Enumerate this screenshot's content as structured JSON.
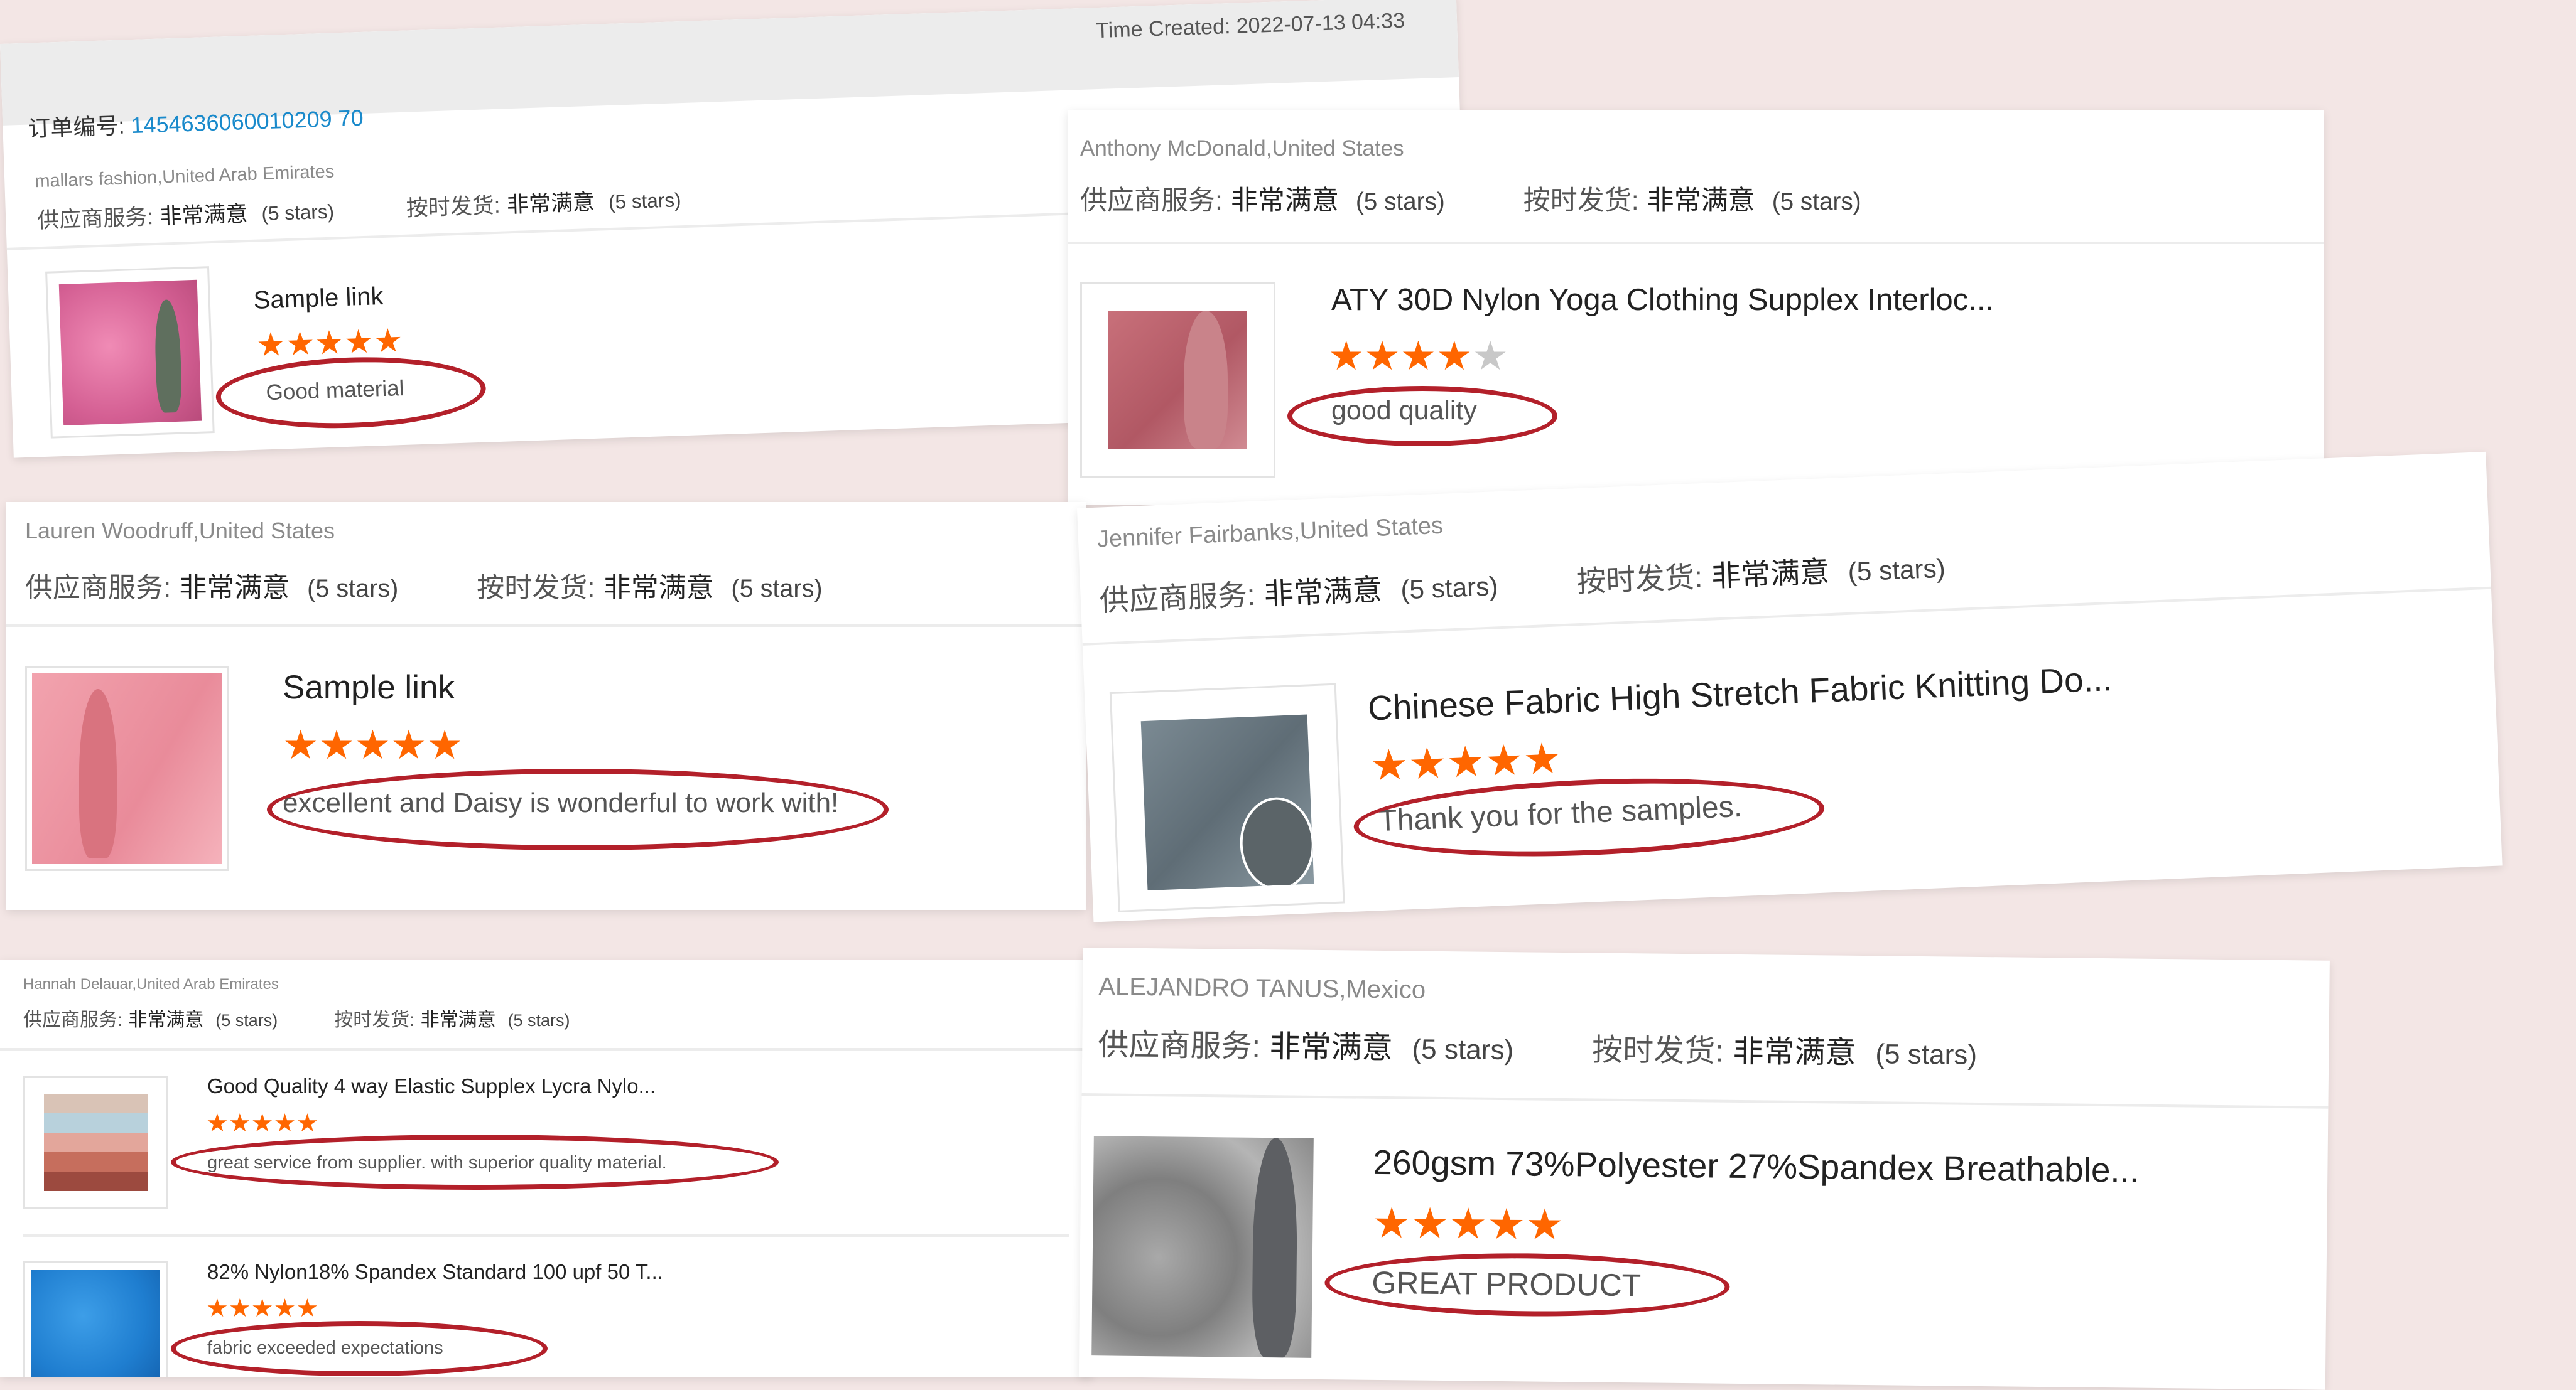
{
  "order": {
    "time_created_label": "Time Created:",
    "time_created_value": "2022-07-13 04:33",
    "number_label": "订单编号:",
    "number_value": "1454636060010209 70"
  },
  "reviews": [
    {
      "reviewer": "mallars fashion,United Arab Emirates",
      "service_label": "供应商服务:",
      "service_value": "非常满意",
      "service_stars": "(5 stars)",
      "delivery_label": "按时发货:",
      "delivery_value": "非常满意",
      "delivery_stars": "(5 stars)",
      "product_name": "Sample link",
      "stars": "★★★★★",
      "stars_off": "",
      "rating": 5,
      "comment": "Good material"
    },
    {
      "reviewer": "Anthony McDonald,United States",
      "service_label": "供应商服务:",
      "service_value": "非常满意",
      "service_stars": "(5 stars)",
      "delivery_label": "按时发货:",
      "delivery_value": "非常满意",
      "delivery_stars": "(5 stars)",
      "product_name": "ATY 30D Nylon Yoga Clothing Supplex Interloc...",
      "stars": "★★★★",
      "stars_off": "★",
      "rating": 4,
      "comment": "good quality"
    },
    {
      "reviewer": "Lauren Woodruff,United States",
      "service_label": "供应商服务:",
      "service_value": "非常满意",
      "service_stars": "(5 stars)",
      "delivery_label": "按时发货:",
      "delivery_value": "非常满意",
      "delivery_stars": "(5 stars)",
      "product_name": "Sample link",
      "stars": "★★★★★",
      "stars_off": "",
      "rating": 5,
      "comment": "excellent and Daisy is wonderful to work with!"
    },
    {
      "reviewer": "Jennifer Fairbanks,United States",
      "service_label": "供应商服务:",
      "service_value": "非常满意",
      "service_stars": "(5 stars)",
      "delivery_label": "按时发货:",
      "delivery_value": "非常满意",
      "delivery_stars": "(5 stars)",
      "product_name": "Chinese Fabric High Stretch Fabric Knitting Do...",
      "stars": "★★★★★",
      "stars_off": "",
      "rating": 5,
      "comment": "Thank you for the samples."
    },
    {
      "reviewer": "Hannah Delauar,United Arab Emirates",
      "service_label": "供应商服务:",
      "service_value": "非常满意",
      "service_stars": "(5 stars)",
      "delivery_label": "按时发货:",
      "delivery_value": "非常满意",
      "delivery_stars": "(5 stars)",
      "products": [
        {
          "product_name": "Good Quality 4 way Elastic Supplex Lycra Nylo...",
          "stars": "★★★★★",
          "rating": 5,
          "comment": "great service from supplier. with superior quality material."
        },
        {
          "product_name": "82% Nylon18% Spandex Standard 100 upf 50 T...",
          "stars": "★★★★★",
          "rating": 5,
          "comment": "fabric exceeded expectations"
        }
      ]
    },
    {
      "reviewer": "ALEJANDRO TANUS,Mexico",
      "service_label": "供应商服务:",
      "service_value": "非常满意",
      "service_stars": "(5 stars)",
      "delivery_label": "按时发货:",
      "delivery_value": "非常满意",
      "delivery_stars": "(5 stars)",
      "product_name": "260gsm 73%Polyester 27%Spandex Breathable...",
      "stars": "★★★★★",
      "stars_off": "",
      "rating": 5,
      "comment": "GREAT PRODUCT"
    }
  ],
  "colors": {
    "star": "#ff6600",
    "star_off": "#c8c8c8",
    "highlight": "#b3202a",
    "order_number": "#1a8acb",
    "background": "#f3e6e5"
  }
}
